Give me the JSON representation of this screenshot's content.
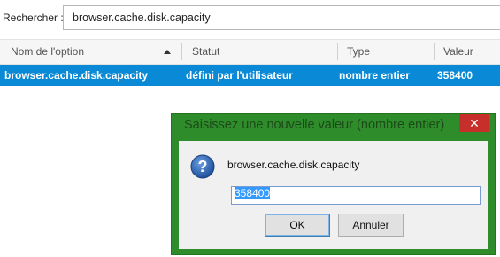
{
  "search": {
    "label": "Rechercher :",
    "value": "browser.cache.disk.capacity"
  },
  "table": {
    "columns": [
      "Nom de l'option",
      "Statut",
      "Type",
      "Valeur"
    ],
    "rows": [
      {
        "name": "browser.cache.disk.capacity",
        "status": "défini par l'utilisateur",
        "type": "nombre entier",
        "value": "358400"
      }
    ]
  },
  "dialog": {
    "title": "Saisissez une nouvelle valeur (nombre entier)",
    "close_label": "✕",
    "icon": "question-icon",
    "message": "browser.cache.disk.capacity",
    "input_value": "358400",
    "ok_label": "OK",
    "cancel_label": "Annuler"
  },
  "colors": {
    "selection": "#0a8ad6",
    "dialog_frame": "#2f8c2b",
    "close_button": "#c7302a"
  }
}
